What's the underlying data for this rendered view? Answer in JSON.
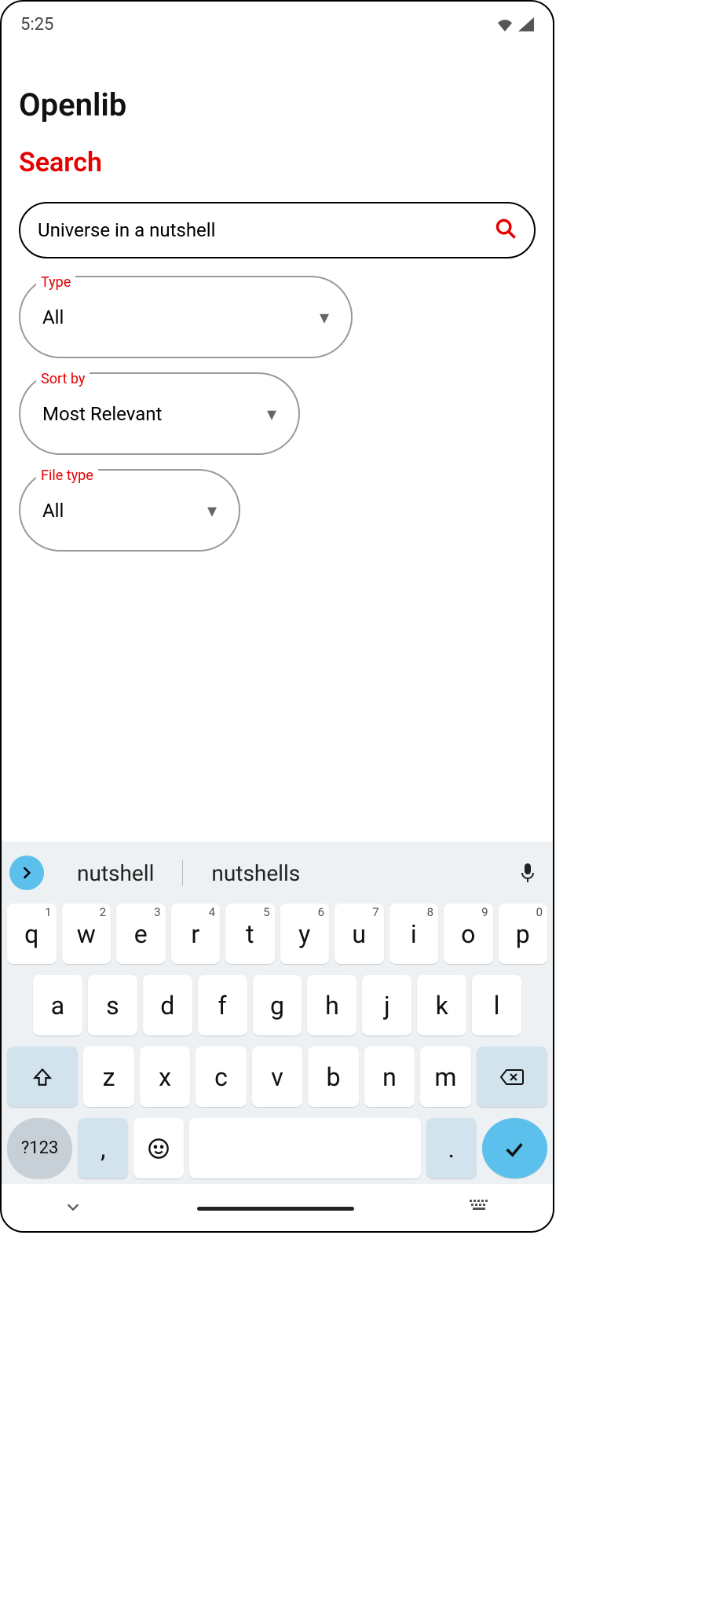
{
  "status": {
    "time": "5:25"
  },
  "app": {
    "title": "Openlib",
    "section": "Search",
    "search_value": "Universe in a nutshell",
    "filters": {
      "type": {
        "label": "Type",
        "value": "All"
      },
      "sort": {
        "label": "Sort by",
        "value": "Most Relevant"
      },
      "file": {
        "label": "File type",
        "value": "All"
      }
    }
  },
  "ime": {
    "suggestions": [
      "nutshell",
      "nutshells"
    ],
    "row1": [
      {
        "k": "q",
        "n": "1"
      },
      {
        "k": "w",
        "n": "2"
      },
      {
        "k": "e",
        "n": "3"
      },
      {
        "k": "r",
        "n": "4"
      },
      {
        "k": "t",
        "n": "5"
      },
      {
        "k": "y",
        "n": "6"
      },
      {
        "k": "u",
        "n": "7"
      },
      {
        "k": "i",
        "n": "8"
      },
      {
        "k": "o",
        "n": "9"
      },
      {
        "k": "p",
        "n": "0"
      }
    ],
    "row2": [
      "a",
      "s",
      "d",
      "f",
      "g",
      "h",
      "j",
      "k",
      "l"
    ],
    "row3": [
      "z",
      "x",
      "c",
      "v",
      "b",
      "n",
      "m"
    ],
    "sym": "?123",
    "comma": ",",
    "period": "."
  }
}
